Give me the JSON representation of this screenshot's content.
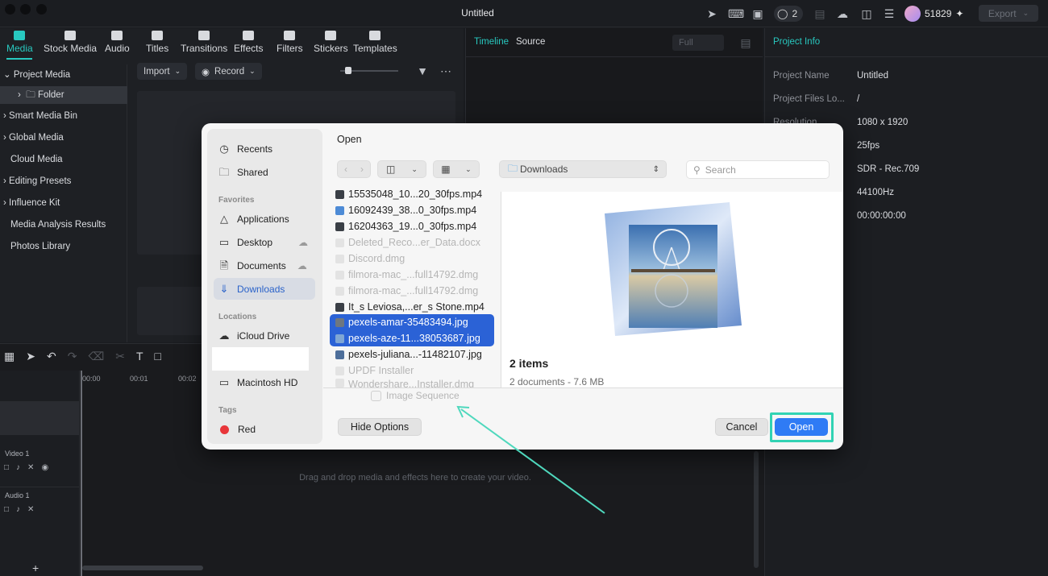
{
  "window": {
    "title": "Untitled"
  },
  "topbar": {
    "credits": "51829",
    "export_label": "Export",
    "badge_count": "2"
  },
  "media_tabs": [
    {
      "label": "Media"
    },
    {
      "label": "Stock Media"
    },
    {
      "label": "Audio"
    },
    {
      "label": "Titles"
    },
    {
      "label": "Transitions"
    },
    {
      "label": "Effects"
    },
    {
      "label": "Filters"
    },
    {
      "label": "Stickers"
    },
    {
      "label": "Templates"
    }
  ],
  "tree": [
    {
      "label": "Project Media"
    },
    {
      "label": "Folder"
    },
    {
      "label": "Smart Media Bin"
    },
    {
      "label": "Global Media"
    },
    {
      "label": "Cloud Media"
    },
    {
      "label": "Editing Presets"
    },
    {
      "label": "Influence Kit"
    },
    {
      "label": "Media Analysis Results"
    },
    {
      "label": "Photos Library"
    }
  ],
  "media_toolbar": {
    "import_label": "Import",
    "record_label": "Record"
  },
  "preview": {
    "tab_timeline": "Timeline",
    "tab_source": "Source",
    "quality": "Full"
  },
  "project_info": {
    "title": "Project Info",
    "rows": [
      {
        "label": "Project Name",
        "value": "Untitled"
      },
      {
        "label": "Project Files Lo...",
        "value": "/"
      },
      {
        "label": "Resolution",
        "value": "1080 x 1920"
      },
      {
        "label": "",
        "value": "25fps"
      },
      {
        "label": "",
        "value": "SDR - Rec.709"
      },
      {
        "label": "",
        "value": "44100Hz"
      },
      {
        "label": "",
        "value": "00:00:00:00"
      }
    ]
  },
  "timeline": {
    "ruler": [
      "00:00",
      "00:01",
      "00:02"
    ],
    "tracks": [
      {
        "label": "Video 1"
      },
      {
        "label": "Audio 1"
      }
    ],
    "drop_hint": "Drag and drop media and effects here to create your video."
  },
  "dialog": {
    "title": "Open",
    "location": "Downloads",
    "search_placeholder": "Search",
    "sidebar": {
      "recents": "Recents",
      "shared": "Shared",
      "favorites_heading": "Favorites",
      "applications": "Applications",
      "desktop": "Desktop",
      "documents": "Documents",
      "downloads": "Downloads",
      "locations_heading": "Locations",
      "icloud": "iCloud Drive",
      "macintosh": "Macintosh HD",
      "tags_heading": "Tags",
      "tag_red": "Red"
    },
    "files": [
      {
        "name": "15535048_10...20_30fps.mp4"
      },
      {
        "name": "16092439_38...0_30fps.mp4"
      },
      {
        "name": "16204363_19...0_30fps.mp4"
      },
      {
        "name": "Deleted_Reco...er_Data.docx"
      },
      {
        "name": "Discord.dmg"
      },
      {
        "name": "filmora-mac_...full14792.dmg"
      },
      {
        "name": "filmora-mac_...full14792.dmg"
      },
      {
        "name": "It_s Leviosa,...er_s Stone.mp4"
      },
      {
        "name": "pexels-amar-35483494.jpg"
      },
      {
        "name": "pexels-aze-11...38053687.jpg"
      },
      {
        "name": "pexels-juliana...-11482107.jpg"
      },
      {
        "name": "UPDF Installer"
      },
      {
        "name": "Wondershare...Installer.dmg"
      }
    ],
    "items_count": "2 items",
    "items_sub": "2 documents - 7.6 MB",
    "image_sequence_label": "Image Sequence",
    "hide_options_label": "Hide Options",
    "cancel_label": "Cancel",
    "open_label": "Open"
  },
  "colors": {
    "accent": "#28c9c0",
    "highlight": "#32d3b4",
    "primary_button": "#2f7bf5",
    "selection": "#2b62d6"
  }
}
